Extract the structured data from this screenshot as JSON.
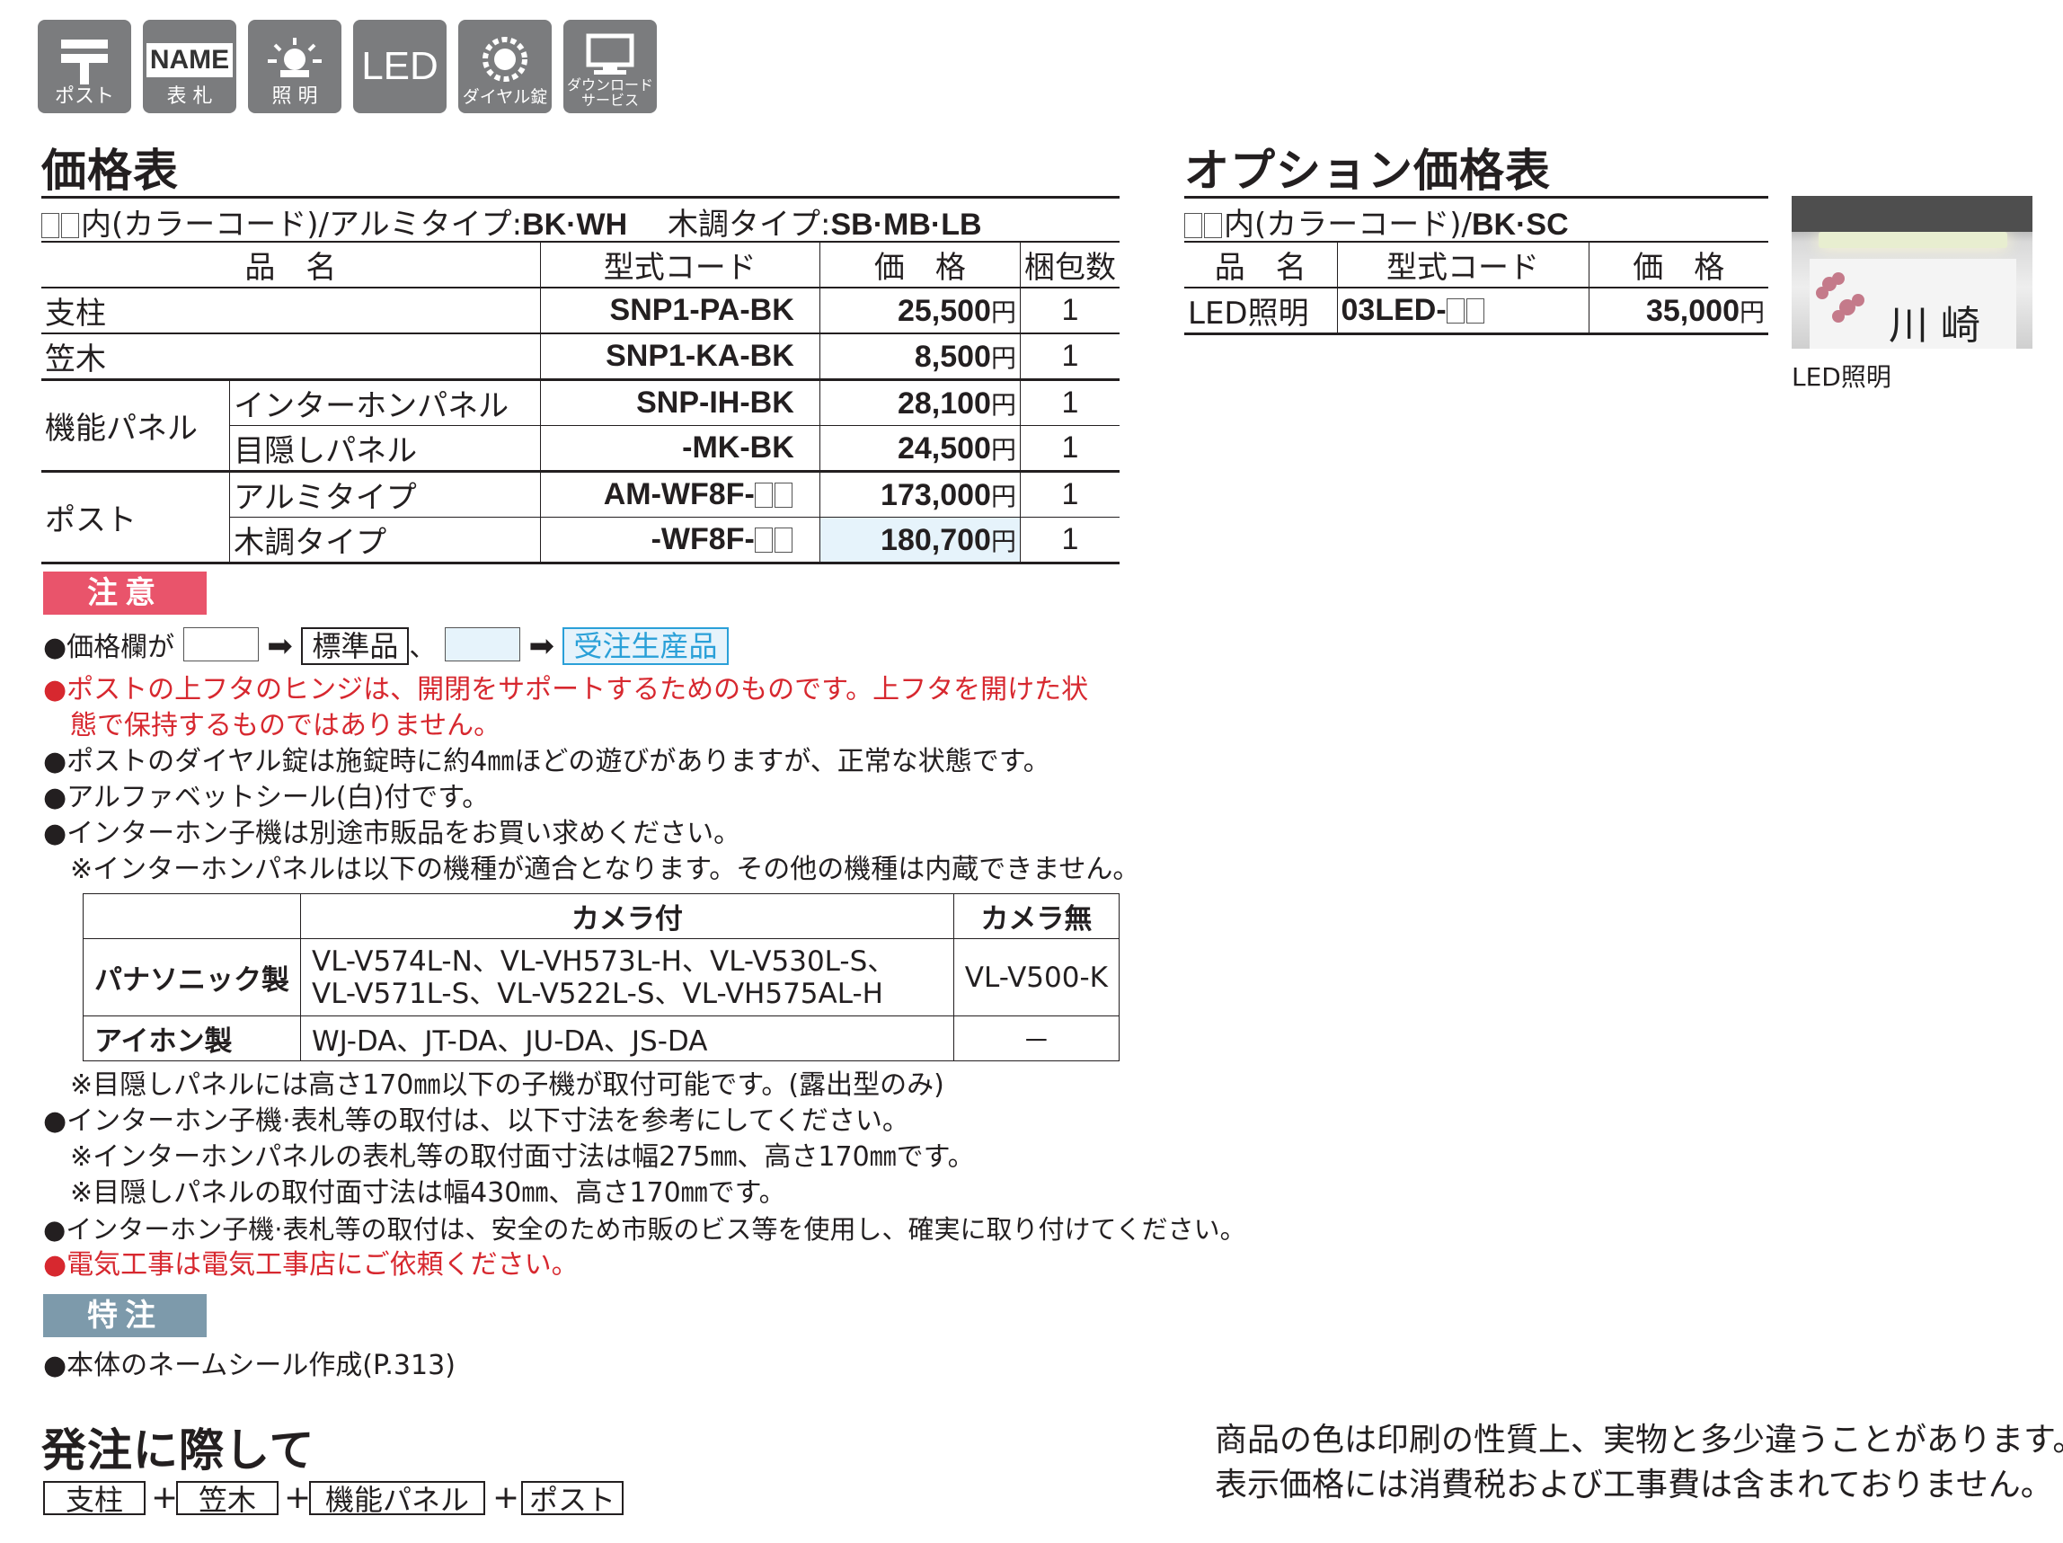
{
  "icons": [
    {
      "name": "post-icon",
      "label": "ポスト"
    },
    {
      "name": "name-plate-icon",
      "top": "NAME",
      "label": "表 札"
    },
    {
      "name": "lighting-icon",
      "label": "照 明"
    },
    {
      "name": "led-icon",
      "top": "LED",
      "label": ""
    },
    {
      "name": "dial-lock-icon",
      "label": "ダイヤル錠"
    },
    {
      "name": "download-service-icon",
      "label": "ダウンロード サービス"
    }
  ],
  "price": {
    "title": "価格表",
    "subtitle_prefix": "内(カラーコード)/アルミタイプ:",
    "subtitle_alu": "BK·WH",
    "subtitle_wood_label": "木調タイプ:",
    "subtitle_wood": "SB·MB·LB",
    "headers": {
      "name": "品　名",
      "code": "型式コード",
      "price": "価　格",
      "qty": "梱包数"
    },
    "rows": [
      {
        "name": "支柱",
        "code": "SNP1-PA-BK",
        "price": "25,500",
        "qty": "1"
      },
      {
        "name": "笠木",
        "code": "SNP1-KA-BK",
        "price": "8,500",
        "qty": "1"
      },
      {
        "group": "機能パネル",
        "name": "インターホンパネル",
        "code": "SNP-IH-BK",
        "price": "28,100",
        "qty": "1"
      },
      {
        "name": "目隠しパネル",
        "code": "-MK-BK",
        "price": "24,500",
        "qty": "1"
      },
      {
        "group": "ポスト",
        "name": "アルミタイプ",
        "code": "AM-WF8F-",
        "price": "173,000",
        "qty": "1"
      },
      {
        "name": "木調タイプ",
        "code": "-WF8F-",
        "price": "180,700",
        "qty": "1"
      }
    ],
    "yen": "円"
  },
  "option": {
    "title": "オプション価格表",
    "subtitle_prefix": "内(カラーコード)/",
    "subtitle_codes": "BK·SC",
    "headers": {
      "name": "品　名",
      "code": "型式コード",
      "price": "価　格"
    },
    "row": {
      "name": "LED照明",
      "code": "03LED-",
      "price": "35,000"
    },
    "photo_caption": "LED照明",
    "photo_plate_text": "川 崎"
  },
  "caution": {
    "tag": "注意",
    "legend_prefix": "●価格欄が",
    "standard": "標準品",
    "separator": "、",
    "made_to_order": "受注生産品",
    "lines": [
      {
        "text": "●ポストの上フタのヒンジは、開閉をサポートするためのものです。上フタを開けた状",
        "red": true
      },
      {
        "text": "　態で保持するものではありません。",
        "red": true
      },
      {
        "text": "●ポストのダイヤル錠は施錠時に約4㎜ほどの遊びがありますが、正常な状態です。",
        "red": false
      },
      {
        "text": "●アルファベットシール(白)付です。",
        "red": false
      },
      {
        "text": "●インターホン子機は別途市販品をお買い求めください。",
        "red": false
      },
      {
        "text": "　※インターホンパネルは以下の機種が適合となります。その他の機種は内蔵できません。",
        "red": false
      }
    ],
    "intercom": {
      "col_camera": "カメラ付",
      "col_nocamera": "カメラ無",
      "rows": [
        {
          "maker": "パナソニック製",
          "camera1": "VL-V574L-N、VL-VH573L-H、VL-V530L-S、",
          "camera2": "VL-V571L-S、VL-V522L-S、VL-VH575AL-H",
          "nocamera": "VL-V500-K"
        },
        {
          "maker": "アイホン製",
          "camera1": "WJ-DA、JT-DA、JU-DA、JS-DA",
          "camera2": "",
          "nocamera": "－"
        }
      ]
    },
    "lines2": [
      {
        "text": "　※目隠しパネルには高さ170㎜以下の子機が取付可能です。(露出型のみ)",
        "red": false
      },
      {
        "text": "●インターホン子機·表札等の取付は、以下寸法を参考にしてください。",
        "red": false
      },
      {
        "text": "　※インターホンパネルの表札等の取付面寸法は幅275㎜、高さ170㎜です。",
        "red": false
      },
      {
        "text": "　※目隠しパネルの取付面寸法は幅430㎜、高さ170㎜です。",
        "red": false
      },
      {
        "text": "●インターホン子機·表札等の取付は、安全のため市販のビス等を使用し、確実に取り付けてください。",
        "red": false
      },
      {
        "text": "●電気工事は電気工事店にご依頼ください。",
        "red": true
      }
    ]
  },
  "special": {
    "tag": "特注",
    "line": "●本体のネームシール作成(P.313)"
  },
  "ordering": {
    "title": "発注に際して",
    "items": [
      "支柱",
      "笠木",
      "機能パネル",
      "ポスト"
    ],
    "plus": "+"
  },
  "disclaimer": [
    "商品の色は印刷の性質上、実物と多少違うことがあります。",
    "表示価格には消費税および工事費は含まれておりません。"
  ],
  "colors": {
    "caution_tag": "#e9546b",
    "special_tag": "#7d9aab",
    "made_to_order_bg": "#e6f3fb",
    "made_to_order_text": "#2aa0d8",
    "icon_bg": "#7b7c7e",
    "red_text": "#d7282f"
  }
}
